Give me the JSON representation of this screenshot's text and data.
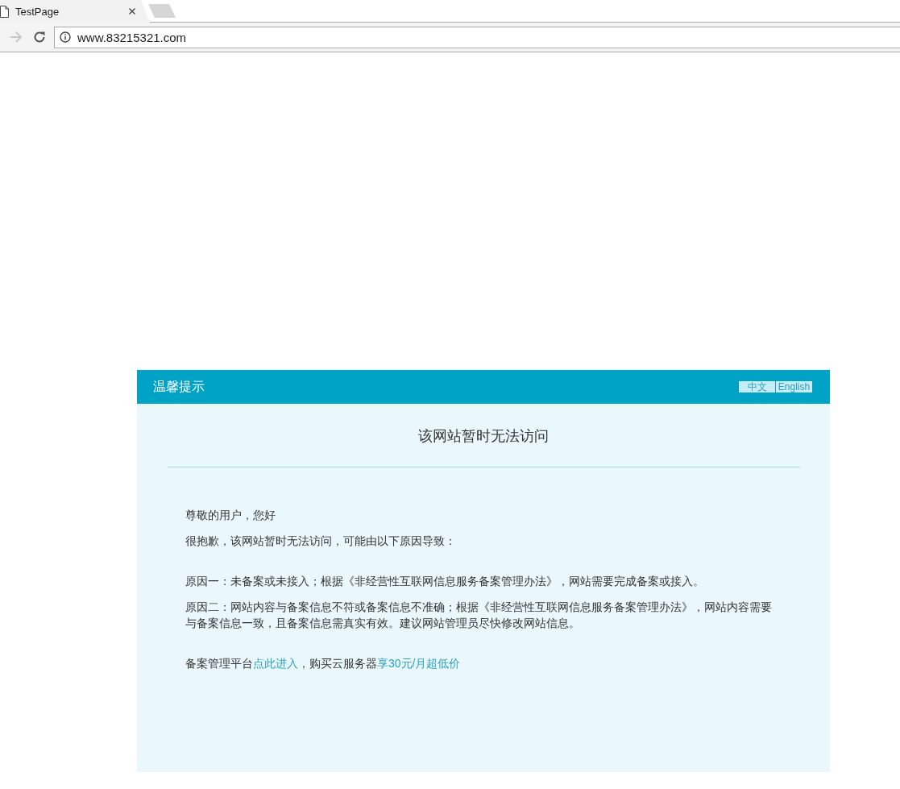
{
  "tabs": [
    {
      "title": "TestPage",
      "selected": true
    }
  ],
  "toolbar": {
    "forward_disabled": true,
    "url": "www.83215321.com"
  },
  "notice": {
    "title": "温馨提示",
    "languages": [
      "中文",
      "English"
    ],
    "heading": "该网站暂时无法访问",
    "greeting": "尊敬的用户，您好",
    "intro": "很抱歉，该网站暂时无法访问，可能由以下原因导致：",
    "reasons": [
      "原因一：未备案或未接入；根据《非经营性互联网信息服务备案管理办法》，网站需要完成备案或接入。",
      "原因二：网站内容与备案信息不符或备案信息不准确；根据《非经营性互联网信息服务备案管理办法》，网站内容需要与备案信息一致，且备案信息需真实有效。建议网站管理员尽快修改网站信息。"
    ],
    "footer": [
      {
        "kind": "text",
        "text": "备案管理平台"
      },
      {
        "kind": "link",
        "text": "点此进入"
      },
      {
        "kind": "text",
        "text": "，购买云服务器"
      },
      {
        "kind": "link",
        "text": "享30元/月超低价"
      }
    ]
  }
}
